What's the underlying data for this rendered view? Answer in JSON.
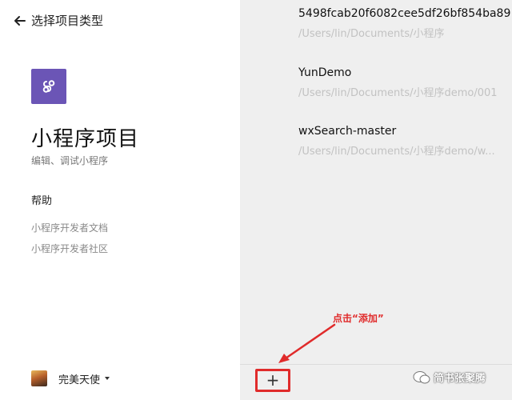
{
  "header": {
    "back_label": "选择项目类型"
  },
  "project_type": {
    "title": "小程序项目",
    "subtitle": "编辑、调试小程序"
  },
  "help": {
    "title": "帮助",
    "links": [
      "小程序开发者文档",
      "小程序开发者社区"
    ]
  },
  "user": {
    "name": "完美天使"
  },
  "projects": [
    {
      "name": "5498fcab20f6082cee5df26bf854ba89",
      "path": "/Users/lin/Documents/小程序"
    },
    {
      "name": "YunDemo",
      "path": "/Users/lin/Documents/小程序demo/001"
    },
    {
      "name": "wxSearch-master",
      "path": "/Users/lin/Documents/小程序demo/w..."
    }
  ],
  "add_button": {
    "label": "+"
  },
  "annotation": {
    "text": "点击“添加”"
  },
  "watermark": {
    "text": "简书张聚腾"
  },
  "colors": {
    "logo_bg": "#6b55b6",
    "right_panel_bg": "#efefef",
    "annotation_red": "#e02b2b",
    "path_gray": "#c2c2c2"
  }
}
